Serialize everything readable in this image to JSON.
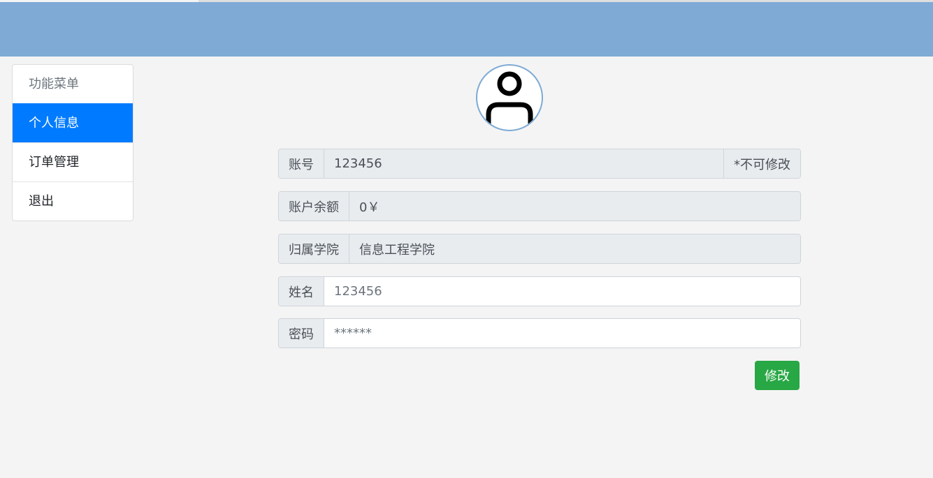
{
  "sidebar": {
    "items": [
      {
        "label": "功能菜单"
      },
      {
        "label": "个人信息"
      },
      {
        "label": "订单管理"
      },
      {
        "label": "退出"
      }
    ]
  },
  "avatar": {
    "icon": "person-outline-icon"
  },
  "form": {
    "account": {
      "label": "账号",
      "value": "123456",
      "note": "*不可修改"
    },
    "balance": {
      "label": "账户余额",
      "value": "0￥"
    },
    "college": {
      "label": "归属学院",
      "value": "信息工程学院"
    },
    "name": {
      "label": "姓名",
      "placeholder": "123456"
    },
    "password": {
      "label": "密码",
      "placeholder": "******"
    },
    "submit_label": "修改"
  },
  "colors": {
    "header": "#7eaad5",
    "active": "#007bff",
    "submit": "#28a745"
  }
}
